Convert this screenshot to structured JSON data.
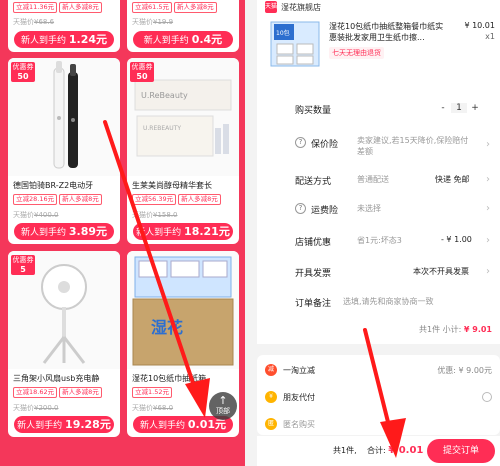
{
  "left": {
    "cards": [
      {
        "title": "",
        "tags": [
          "立减11.36元",
          "新人多减8元"
        ],
        "old_price_label": "天猫价",
        "old_price": "¥68.6",
        "cta_prefix": "新人到手约",
        "cta_price": "1.24元"
      },
      {
        "title": "",
        "tags": [
          "立减61.5元",
          "新人多减8元"
        ],
        "old_price_label": "天猫价",
        "old_price": "¥19.9",
        "cta_prefix": "新人到手约",
        "cta_price": "0.4元"
      },
      {
        "badge_top": "优惠券",
        "badge_val": "50",
        "title": "德国铂骑BR-Z2电动牙",
        "tags": [
          "立减28.16元",
          "新人多减8元"
        ],
        "old_price_label": "天猫价",
        "old_price": "¥400.0",
        "cta_prefix": "新人到手约",
        "cta_price": "3.89元"
      },
      {
        "badge_top": "优惠券",
        "badge_val": "50",
        "title": "生莱美尚醇母精华套长",
        "tags": [
          "立减56.39元",
          "新人多减8元"
        ],
        "old_price_label": "天猫价",
        "old_price": "¥158.0",
        "cta_prefix": "新人到手约",
        "cta_price": "18.21元"
      },
      {
        "badge_top": "优惠券",
        "badge_val": "5",
        "title": "三角架小风扇usb充电静",
        "tags": [
          "立减18.62元",
          "新人多减8元"
        ],
        "old_price_label": "天猫价",
        "old_price": "¥200.0",
        "cta_prefix": "新人到手约",
        "cta_price": "19.28元"
      },
      {
        "title": "湿花10包纸巾抽纸箱",
        "tags": [
          "立减1.52元"
        ],
        "old_price_label": "天猫价",
        "old_price": "¥68.0",
        "cta_prefix": "新人到手约",
        "cta_price": "0.01元"
      }
    ],
    "top_button": {
      "arrow": "↑",
      "label": "顶部"
    }
  },
  "right": {
    "shop_icon": "天猫",
    "shop_name": "湿花旗舰店",
    "product": {
      "title": "湿花10包纸巾抽纸整箱餐巾纸实惠装批发家用卫生纸巾擦...",
      "price": "¥ 10.01",
      "qty": "x1",
      "tag": "七天无理由退货"
    },
    "rows": {
      "buy_qty_label": "购买数量",
      "qty_minus": "-",
      "qty_value": "1",
      "qty_plus": "+",
      "insurance_label": "保价险",
      "insurance_val": "卖家建议,若15天降价,保险赔付差额",
      "shipping_label": "配送方式",
      "shipping_val": "普通配送",
      "shipping_right": "快递 免邮",
      "return_label": "运费险",
      "return_val": "未选择",
      "shop_promo_label": "店铺优惠",
      "shop_promo_val": "省1元:坏态3",
      "shop_promo_right": "- ¥ 1.00",
      "invoice_label": "开具发票",
      "invoice_right": "本次不开具发票",
      "note_label": "订单备注",
      "note_val": "选填,请先和商家协商一致"
    },
    "subtotal": {
      "count": "共1件",
      "label": "小计:",
      "amount": "¥ 9.01"
    },
    "promo": {
      "discount_label": "一淘立减",
      "discount_val": "优惠: ¥ 9.00元",
      "friend_pay": "朋友代付",
      "anonymous": "匿名购买"
    },
    "bottom": {
      "count": "共1件,",
      "total_label": "合计:",
      "total_amount": "¥ 0.01",
      "submit": "提交订单"
    }
  }
}
